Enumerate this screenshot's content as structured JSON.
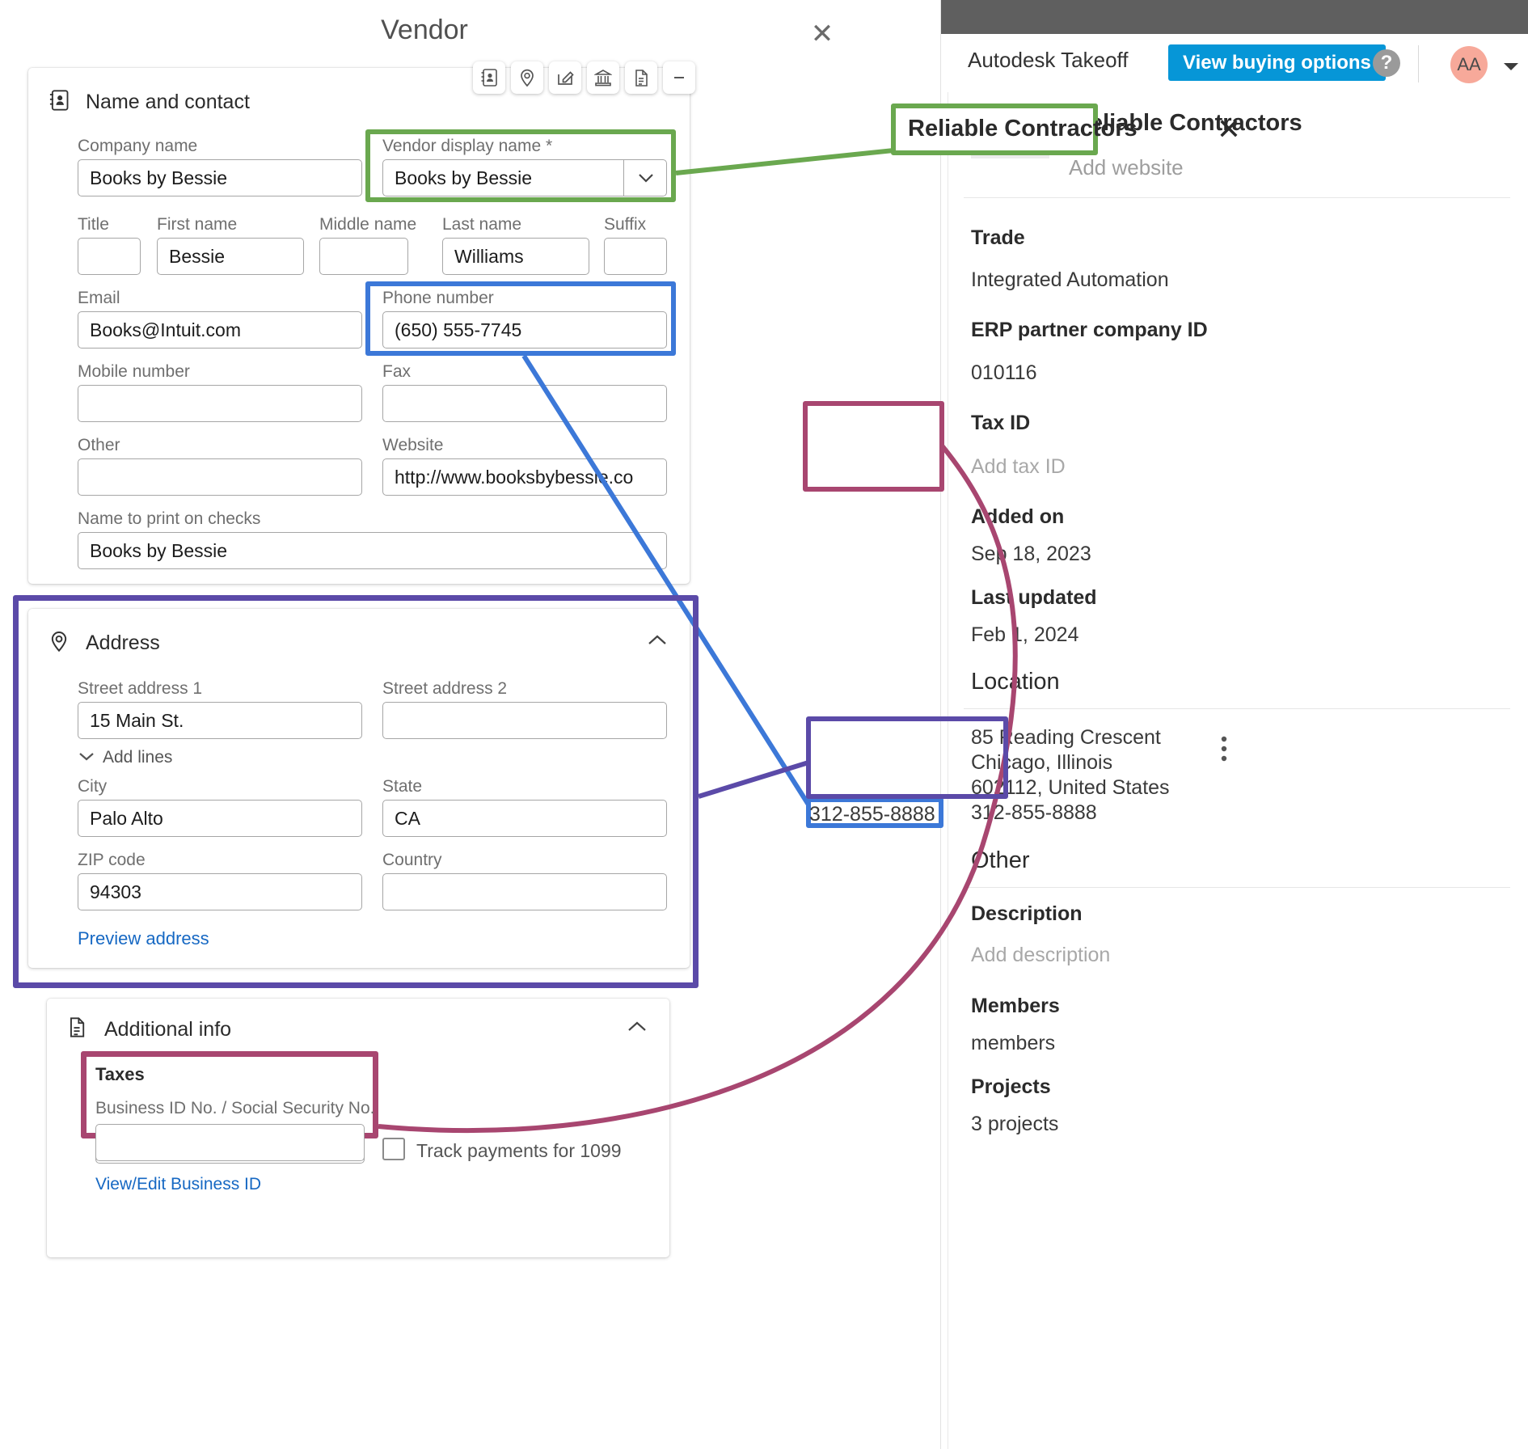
{
  "vendor_dialog": {
    "title": "Vendor",
    "close_icon": "close-icon",
    "toolbar_icons": [
      "address-book-icon",
      "map-pin-icon",
      "edit-pencil-icon",
      "bank-icon",
      "document-icon",
      "minimize-icon"
    ],
    "sections": {
      "name_contact": {
        "heading": "Name and contact",
        "icon": "address-book-icon",
        "fields": {
          "company_name": {
            "label": "Company name",
            "value": "Books by Bessie"
          },
          "vendor_display_name": {
            "label": "Vendor display name *",
            "value": "Books by Bessie"
          },
          "title": {
            "label": "Title",
            "value": ""
          },
          "first_name": {
            "label": "First name",
            "value": "Bessie"
          },
          "middle_name": {
            "label": "Middle name",
            "value": ""
          },
          "last_name": {
            "label": "Last name",
            "value": "Williams"
          },
          "suffix": {
            "label": "Suffix",
            "value": ""
          },
          "email": {
            "label": "Email",
            "value": "Books@Intuit.com"
          },
          "phone_number": {
            "label": "Phone number",
            "value": "(650) 555-7745"
          },
          "mobile_number": {
            "label": "Mobile number",
            "value": ""
          },
          "fax": {
            "label": "Fax",
            "value": ""
          },
          "other": {
            "label": "Other",
            "value": ""
          },
          "website": {
            "label": "Website",
            "value": "http://www.booksbybessie.co"
          },
          "name_on_checks": {
            "label": "Name to print on checks",
            "value": "Books by Bessie"
          }
        }
      },
      "address": {
        "heading": "Address",
        "icon": "map-pin-icon",
        "collapse_icon": "chevron-up-icon",
        "fields": {
          "street1": {
            "label": "Street address 1",
            "value": "15 Main St."
          },
          "street2": {
            "label": "Street address 2",
            "value": ""
          },
          "city": {
            "label": "City",
            "value": "Palo Alto"
          },
          "state": {
            "label": "State",
            "value": "CA"
          },
          "zip": {
            "label": "ZIP code",
            "value": "94303"
          },
          "country": {
            "label": "Country",
            "value": ""
          }
        },
        "add_lines_label": "Add lines",
        "add_lines_icon": "chevron-down-icon",
        "preview_address_label": "Preview address"
      },
      "additional_info": {
        "heading": "Additional info",
        "icon": "document-icon",
        "collapse_icon": "chevron-up-icon",
        "taxes_heading": "Taxes",
        "business_id_label": "Business ID No. / Social Security No.",
        "business_id_value": "",
        "track_1099_label": "Track payments for 1099",
        "track_1099_checked": false,
        "view_edit_business_id_label": "View/Edit Business ID"
      }
    }
  },
  "autodesk_panel": {
    "app_name": "Autodesk Takeoff",
    "buy_button_label": "View buying options",
    "help_icon": "question-mark-icon",
    "avatar_initials": "AA",
    "avatar_caret_icon": "chevron-down-icon",
    "close_icon": "close-icon",
    "company_thumb_icon": "building-icon",
    "company_name": "Reliable Contractors",
    "add_website_label": "Add website",
    "kebab_icon": "more-vertical-icon",
    "details": [
      {
        "key": "Trade",
        "value": "Integrated Automation",
        "muted": false
      },
      {
        "key": "ERP partner company ID",
        "value": "010116",
        "muted": false
      },
      {
        "key": "Tax ID",
        "value": "Add tax ID",
        "muted": true
      },
      {
        "key": "Added on",
        "value": "Sep 18, 2023",
        "muted": false
      },
      {
        "key": "Last updated",
        "value": "Feb 1, 2024",
        "muted": false
      }
    ],
    "location_heading": "Location",
    "location_lines": [
      "85 Reading Crescent",
      "Chicago, Illinois",
      "602112, United States"
    ],
    "location_phone": "312-855-8888",
    "other_heading": "Other",
    "other_details": [
      {
        "key": "Description",
        "value": "Add description",
        "muted": true
      },
      {
        "key": "Members",
        "value": "members",
        "muted": false
      },
      {
        "key": "Projects",
        "value": "3 projects",
        "muted": false
      }
    ]
  },
  "annotations": {
    "green": {
      "color": "#6aa84f",
      "label": "vendor-display-name-to-company-name"
    },
    "blue": {
      "color": "#3c78d8",
      "label": "phone-number-to-location-phone"
    },
    "purple": {
      "color": "#5b4aa8",
      "label": "address-section-to-location-address"
    },
    "magenta": {
      "color": "#a84670",
      "label": "taxes-to-tax-id"
    }
  }
}
